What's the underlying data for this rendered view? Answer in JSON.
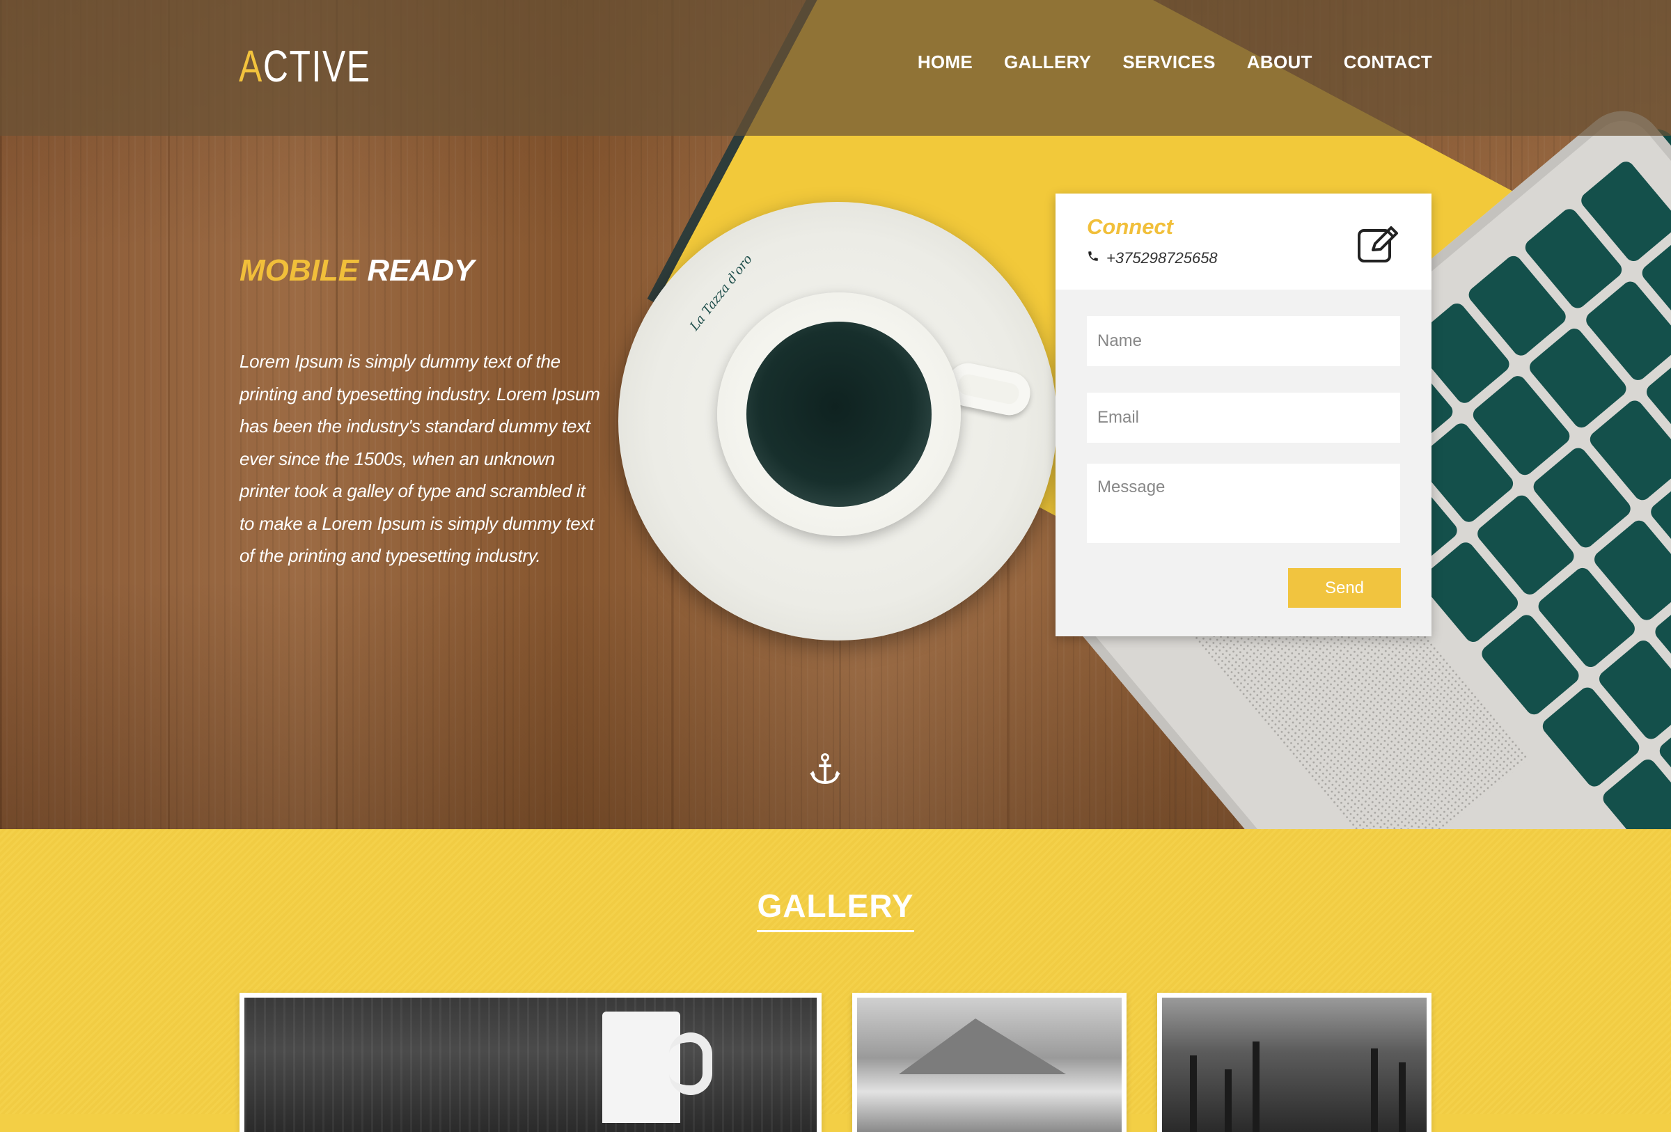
{
  "header": {
    "logo_first": "A",
    "logo_rest": "CTIVE",
    "nav": [
      "HOME",
      "GALLERY",
      "SERVICES",
      "ABOUT",
      "CONTACT"
    ]
  },
  "hero": {
    "title_highlight": "MOBILE",
    "title_rest": " READY",
    "body": "Lorem Ipsum is simply dummy text of the printing and typesetting industry. Lorem Ipsum has been the industry's standard dummy text ever since the 1500s, when an unknown printer took a galley of type and scrambled it to make a Lorem Ipsum is simply dummy text of the printing and typesetting industry.",
    "saucer_brand": "La Tazza d'oro"
  },
  "contact_card": {
    "title": "Connect",
    "phone": "+375298725658",
    "name_placeholder": "Name",
    "email_placeholder": "Email",
    "message_placeholder": "Message",
    "send_label": "Send"
  },
  "gallery": {
    "title": "GALLERY"
  },
  "colors": {
    "accent": "#f1bf3a",
    "gallery_bg": "#f3cf45",
    "header_overlay": "rgba(105,82,52,0.72)"
  },
  "icons": [
    "phone-icon",
    "edit-icon",
    "anchor-icon"
  ]
}
